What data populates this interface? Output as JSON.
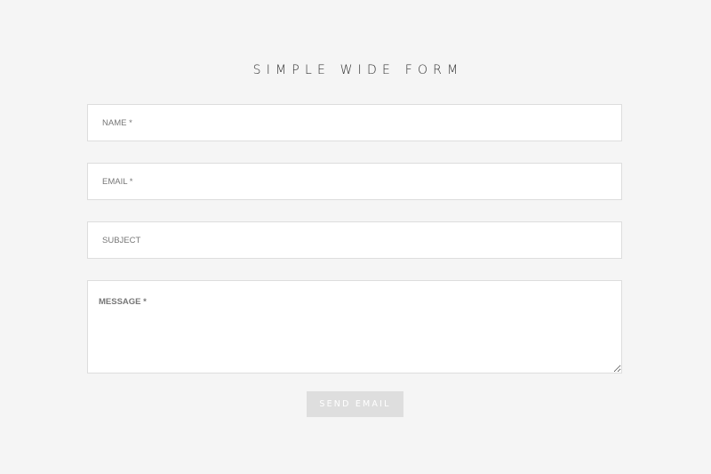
{
  "form": {
    "title": "SIMPLE WIDE FORM",
    "fields": {
      "name": {
        "value": "",
        "placeholder": "NAME *"
      },
      "email": {
        "value": "",
        "placeholder": "EMAIL *"
      },
      "subject": {
        "value": "",
        "placeholder": "SUBJECT"
      },
      "message": {
        "value": "",
        "placeholder": "MESSAGE *"
      }
    },
    "submit_label": "SEND EMAIL"
  },
  "colors": {
    "page_background": "#f5f5f5",
    "field_background": "#ffffff",
    "field_border": "#dddddd",
    "button_background": "#dedede",
    "button_text": "#ffffff"
  }
}
